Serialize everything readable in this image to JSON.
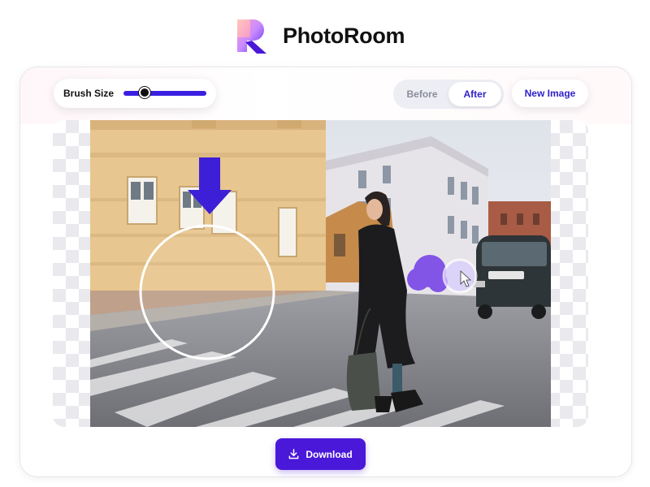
{
  "app": {
    "title": "PhotoRoom"
  },
  "toolbar": {
    "brush_label": "Brush Size",
    "brush_value": 0.25,
    "before_label": "Before",
    "after_label": "After",
    "active_view": "After",
    "new_image_label": "New Image"
  },
  "actions": {
    "download_label": "Download"
  },
  "colors": {
    "accent": "#4a18d8",
    "accent_text": "#2d1fc9",
    "slider": "#3a1fe0"
  },
  "icons": [
    "photoroom-logo-icon",
    "arrow-down-icon",
    "download-icon",
    "cursor-icon"
  ]
}
